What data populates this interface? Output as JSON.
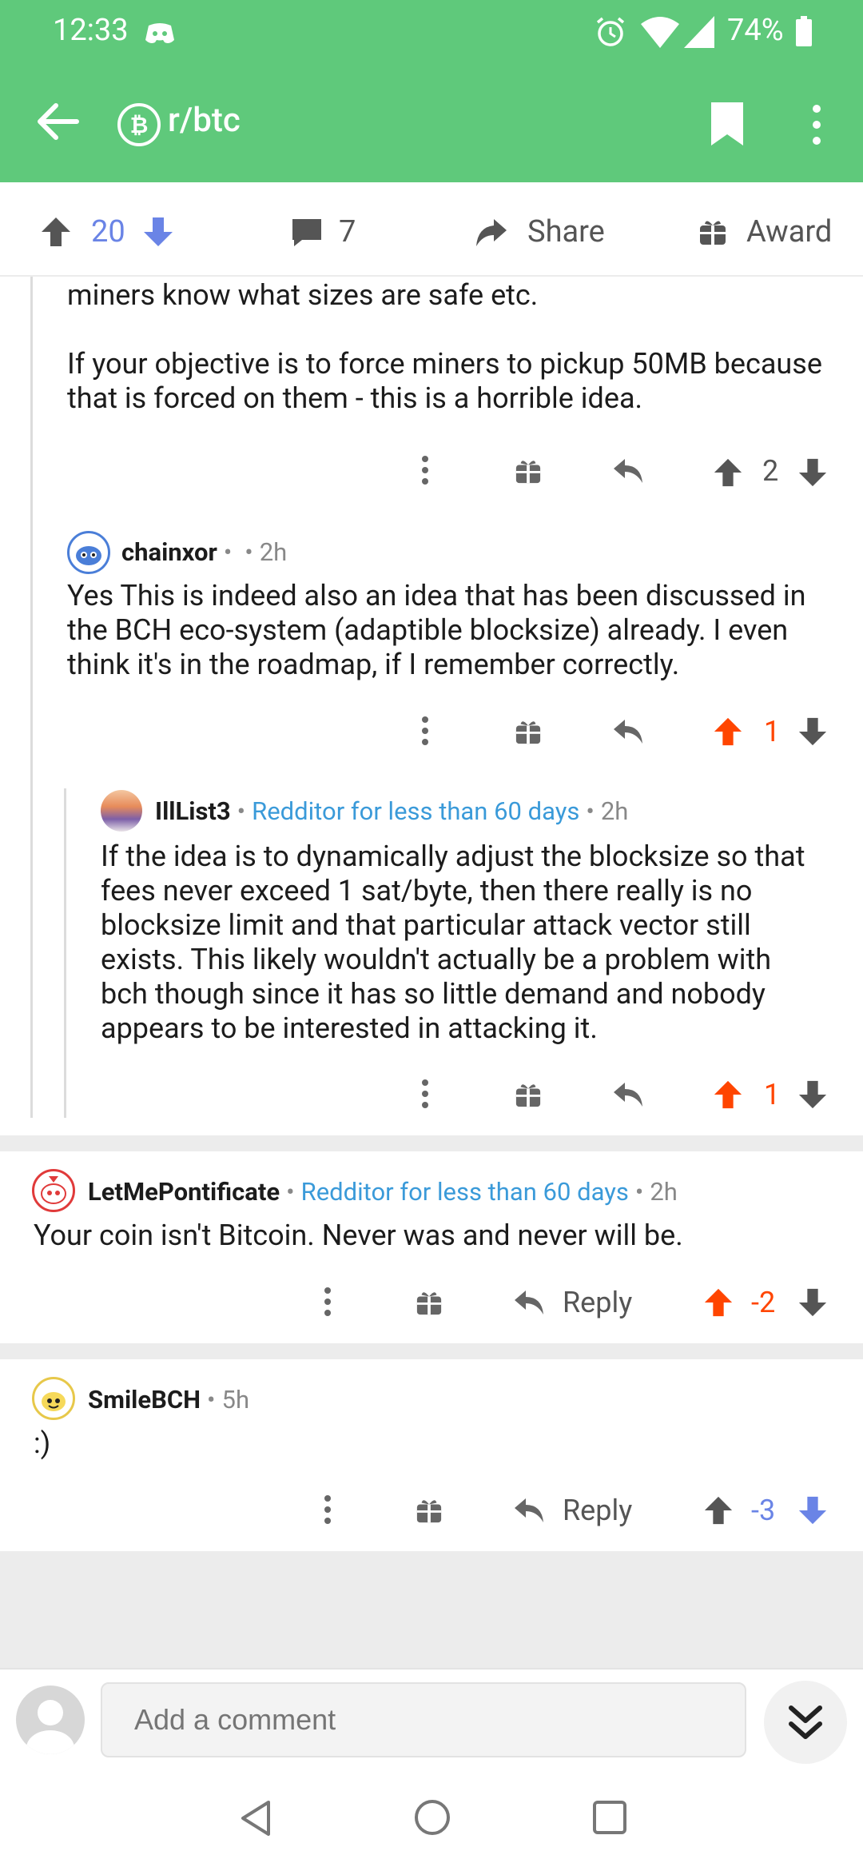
{
  "status": {
    "time": "12:33",
    "battery": "74%"
  },
  "appbar": {
    "title": "r/btc"
  },
  "post_actions": {
    "score": "20",
    "comments": "7",
    "share": "Share",
    "award": "Award"
  },
  "comments": [
    {
      "text_lines": [
        "miners know what sizes are safe etc.",
        "",
        "If your objective is to force miners to pickup 50MB because that is forced on them - this is a horrible idea."
      ],
      "score": "2"
    },
    {
      "username": "chainxor",
      "time": "2h",
      "text": "Yes  This is indeed also an idea that has been discussed in the BCH eco-system (adaptible blocksize) already. I even think it's in the roadmap, if I remember correctly.",
      "score": "1"
    },
    {
      "username": "IllList3",
      "flair": "Redditor for less than 60 days",
      "time": "2h",
      "text": "If the idea is to dynamically adjust the blocksize so that fees never exceed 1 sat/byte, then there really is no blocksize limit and that particular attack vector still exists.  This likely wouldn't actually be a problem with bch though since it has so little demand and nobody appears to be interested in attacking it.",
      "score": "1"
    },
    {
      "username": "LetMePontificate",
      "flair": "Redditor for less than 60 days",
      "time": "2h",
      "text": "Your coin isn't Bitcoin. Never was and never will be.",
      "reply": "Reply",
      "score": "-2"
    },
    {
      "username": "SmileBCH",
      "time": "5h",
      "text": ":)",
      "reply": "Reply",
      "score": "-3"
    }
  ],
  "comment_input": {
    "placeholder": "Add a comment"
  },
  "colors": {
    "appbar": "#5fc97b",
    "upvote": "#ff4500",
    "downvote": "#6a84e6",
    "flair": "#3a9ad9"
  }
}
